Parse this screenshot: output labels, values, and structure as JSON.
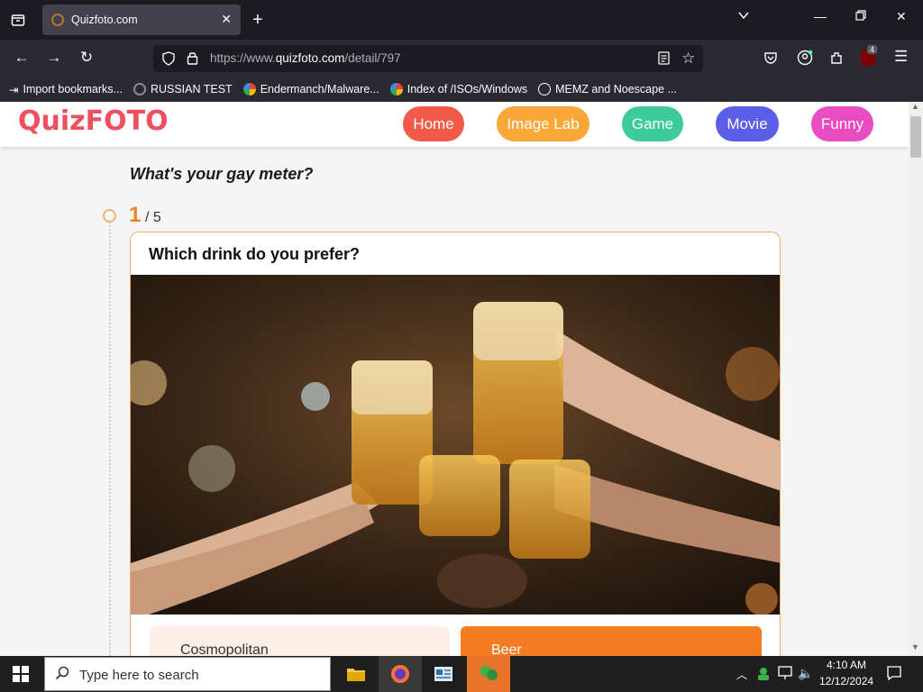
{
  "browser": {
    "tab_title": "Quizfoto.com",
    "url_prefix": "https://www.",
    "url_domain": "quizfoto.com",
    "url_path": "/detail/797",
    "extension_badge": "4"
  },
  "bookmarks": [
    {
      "label": "Import bookmarks...",
      "icon": "import-icon"
    },
    {
      "label": "RUSSIAN TEST",
      "icon": "page-icon"
    },
    {
      "label": "Endermanch/Malware...",
      "icon": "google-icon"
    },
    {
      "label": "Index of /ISOs/Windows",
      "icon": "google-icon"
    },
    {
      "label": "MEMZ and Noescape ...",
      "icon": "globe-icon"
    }
  ],
  "site": {
    "logo": "QuizFOTO",
    "nav": [
      {
        "label": "Home",
        "color": "#f25a4a"
      },
      {
        "label": "Image Lab",
        "color": "#f9a838"
      },
      {
        "label": "Game",
        "color": "#3ecb9c"
      },
      {
        "label": "Movie",
        "color": "#5b5ee8"
      },
      {
        "label": "Funny",
        "color": "#e94bc0"
      }
    ]
  },
  "quiz": {
    "title": "What's your gay meter?",
    "current": "1",
    "total": "/ 5",
    "question": "Which drink do you prefer?",
    "choices": [
      {
        "label": "Cosmopolitan",
        "selected": false
      },
      {
        "label": "Beer",
        "selected": true
      }
    ],
    "accent_color": "#f47b20"
  },
  "taskbar": {
    "search_placeholder": "Type here to search",
    "time": "4:10 AM",
    "date": "12/12/2024"
  }
}
